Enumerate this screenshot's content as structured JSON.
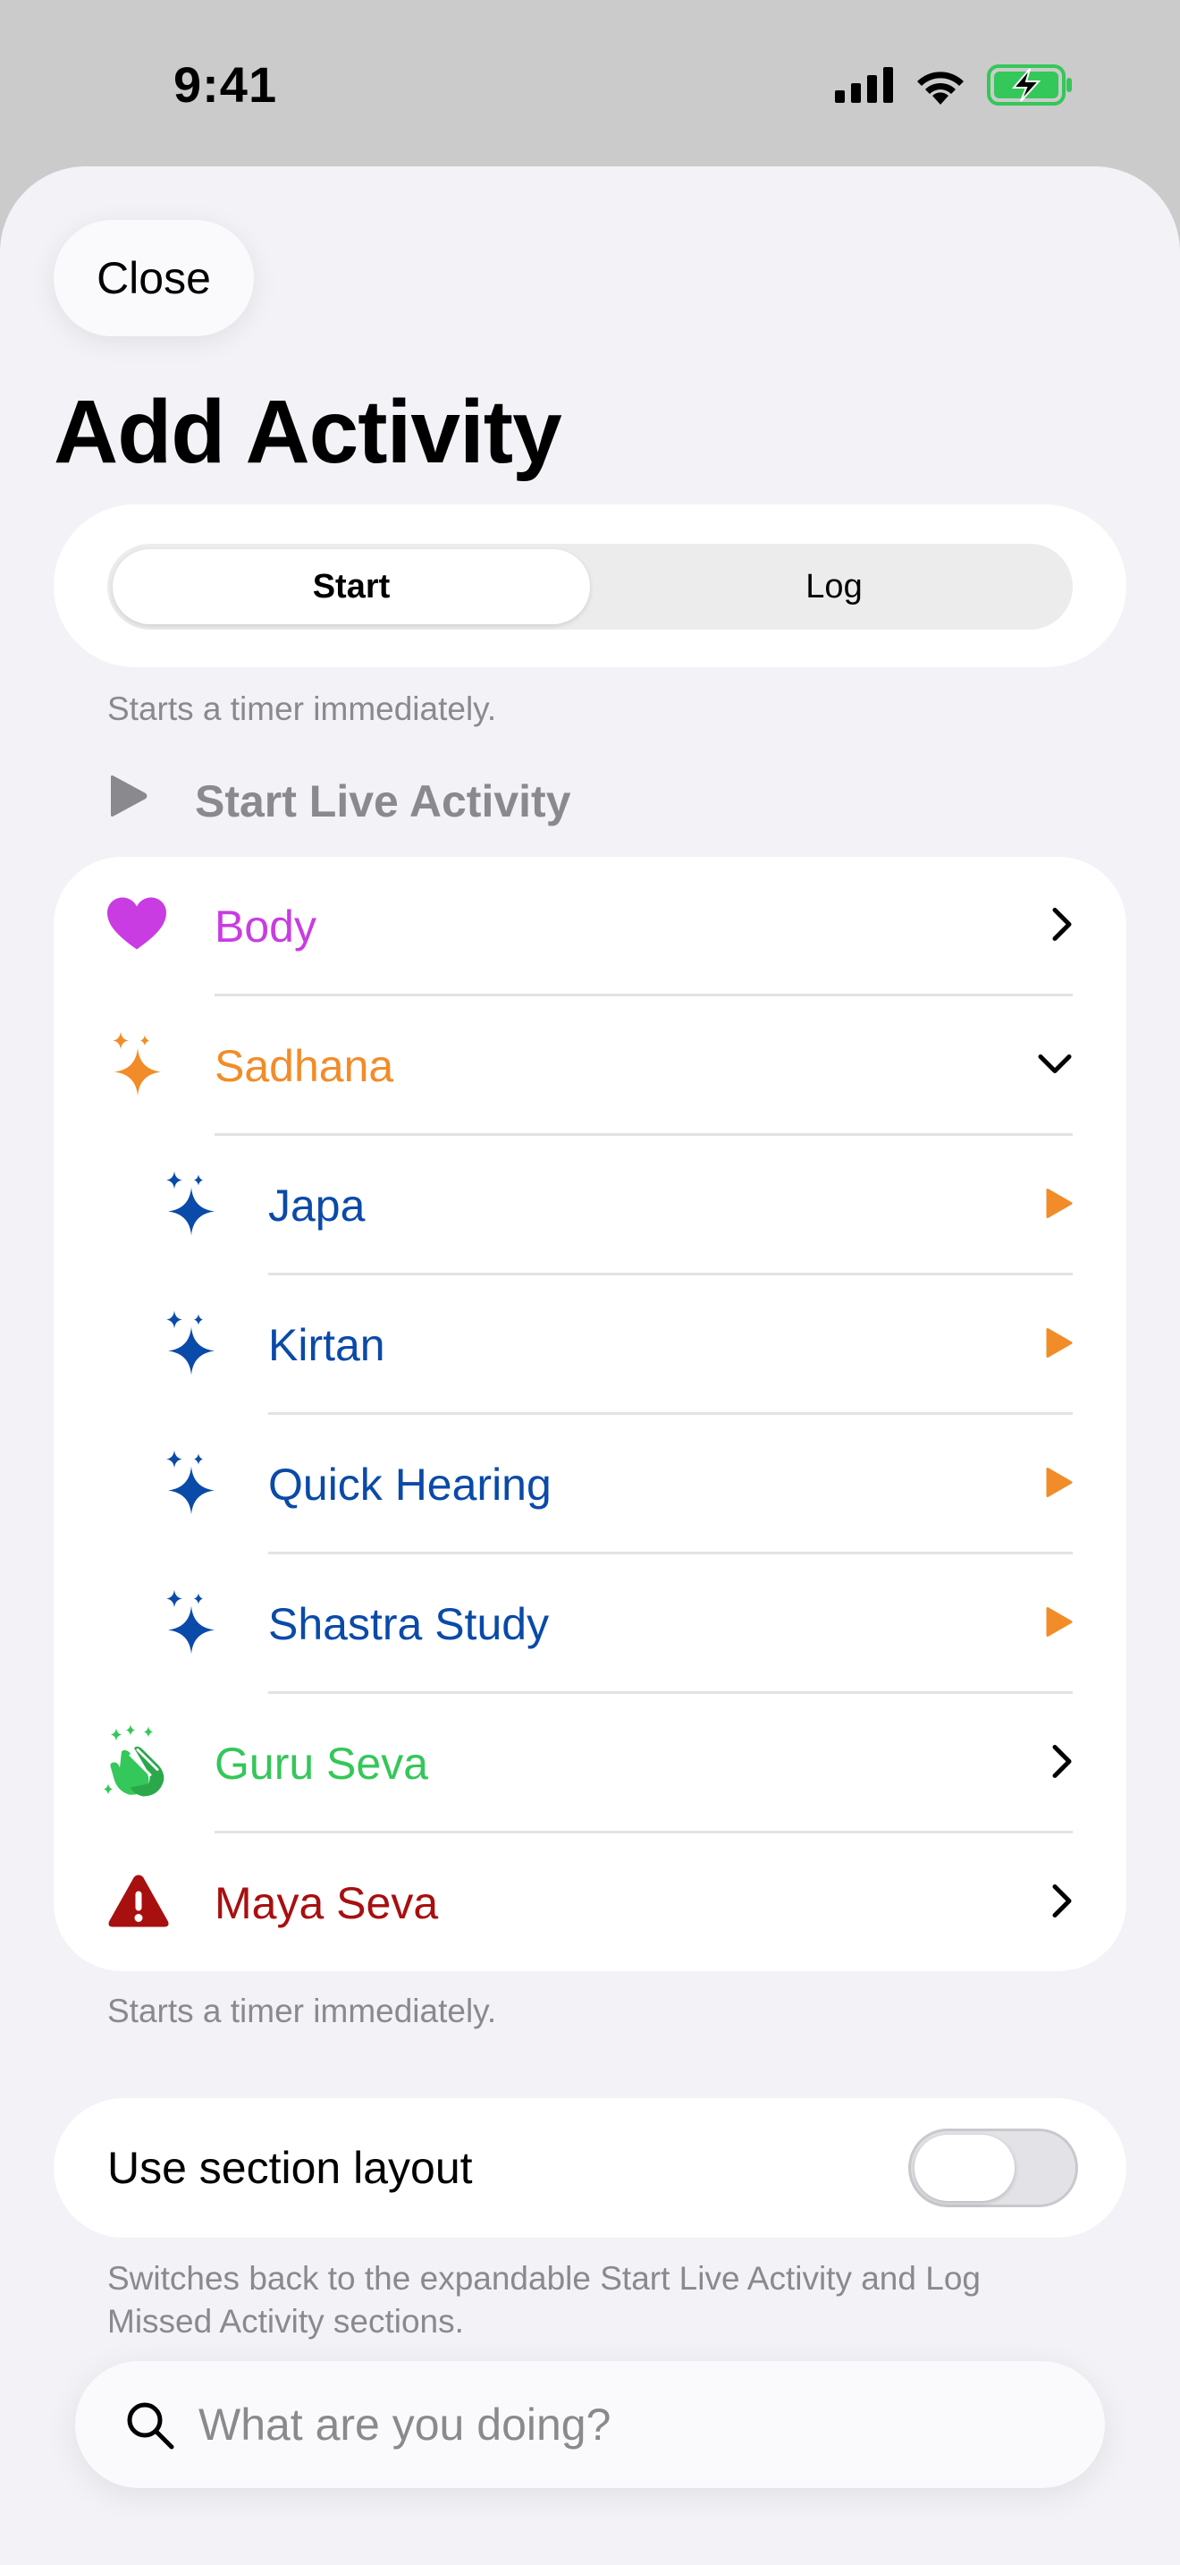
{
  "status": {
    "time": "9:41"
  },
  "close_label": "Close",
  "title": "Add Activity",
  "mode_segments": [
    {
      "label": "Start",
      "selected": true
    },
    {
      "label": "Log",
      "selected": false
    }
  ],
  "segment_footnote": "Starts a timer immediately.",
  "section_header": "Start Live Activity",
  "categories": [
    {
      "label": "Body",
      "color": "#c93ce2",
      "icon": "heart-icon",
      "trailing": "chevron-right-icon"
    },
    {
      "label": "Sadhana",
      "color": "#f28c28",
      "icon": "sparkles-icon",
      "trailing": "chevron-down-icon",
      "expanded": true,
      "children": [
        {
          "label": "Japa",
          "color": "#0a4aa8",
          "icon": "sparkles-icon",
          "trailing": "play-icon"
        },
        {
          "label": "Kirtan",
          "color": "#0a4aa8",
          "icon": "sparkles-icon",
          "trailing": "play-icon"
        },
        {
          "label": "Quick Hearing",
          "color": "#0a4aa8",
          "icon": "sparkles-icon",
          "trailing": "play-icon"
        },
        {
          "label": "Shastra Study",
          "color": "#0a4aa8",
          "icon": "sparkles-icon",
          "trailing": "play-icon"
        }
      ]
    },
    {
      "label": "Guru Seva",
      "color": "#34c759",
      "icon": "clapping-hands-icon",
      "trailing": "chevron-right-icon"
    },
    {
      "label": "Maya Seva",
      "color": "#a80f0f",
      "icon": "warning-icon",
      "trailing": "chevron-right-icon"
    }
  ],
  "list_footnote": "Starts a timer immediately.",
  "toggle": {
    "label": "Use section layout",
    "on": false
  },
  "toggle_footnote": "Switches back to the expandable Start Live Activity and Log Missed Activity sections.",
  "search": {
    "placeholder": "What are you doing?",
    "value": ""
  },
  "accent_play": "#f28c28"
}
